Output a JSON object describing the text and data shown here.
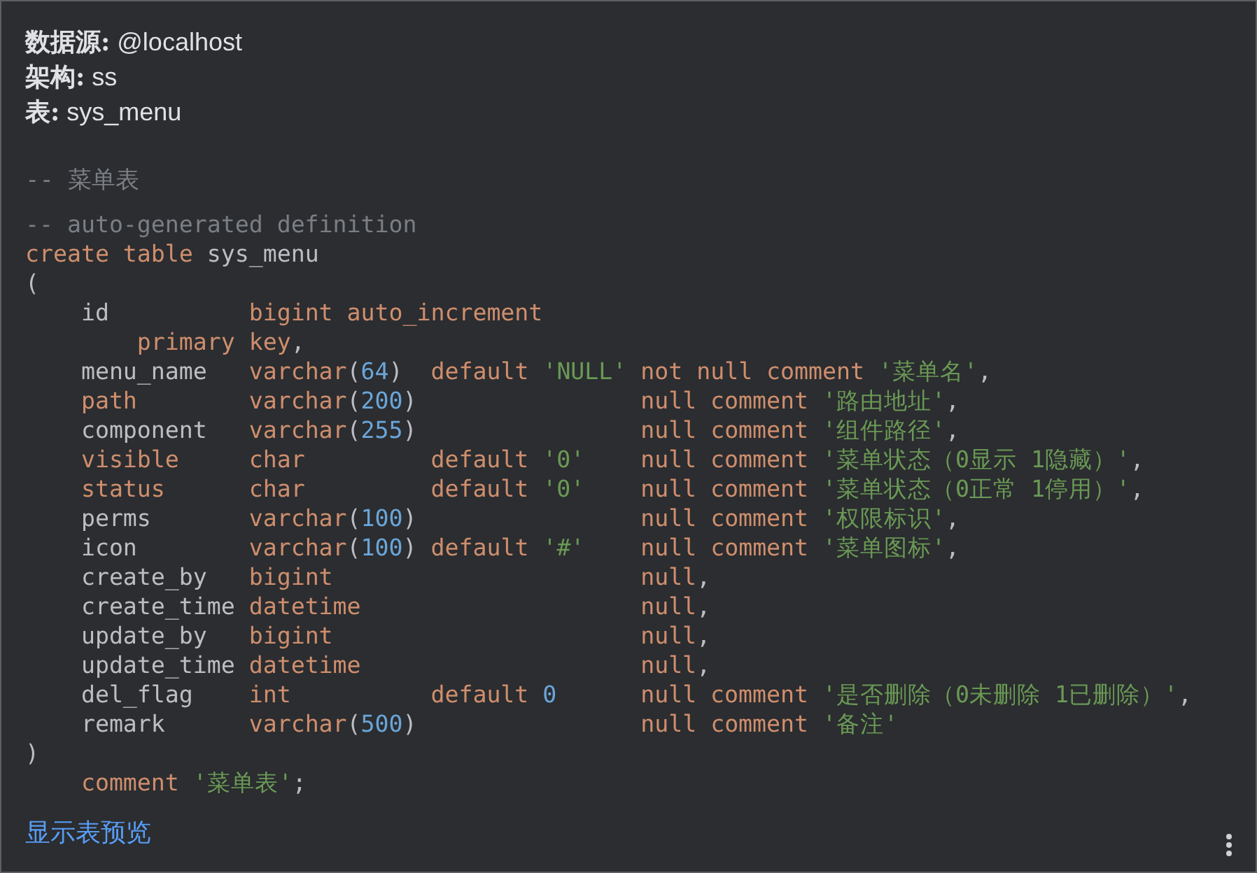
{
  "header": [
    {
      "label": "数据源:",
      "value": "@localhost"
    },
    {
      "label": "架构:",
      "value": "ss"
    },
    {
      "label": "表:",
      "value": "sys_menu"
    }
  ],
  "table_comment": "-- 菜单表",
  "code_lines": [
    [
      {
        "kind": "comment",
        "text": "-- auto-generated definition"
      }
    ],
    [
      {
        "kind": "keyword",
        "text": "create table"
      },
      {
        "kind": "identifier",
        "text": " sys_menu"
      }
    ],
    [
      {
        "kind": "punctuation",
        "text": "("
      }
    ],
    [
      {
        "kind": "identifier",
        "text": "    id          "
      },
      {
        "kind": "keyword",
        "text": "bigint auto_increment"
      }
    ],
    [
      {
        "kind": "keyword",
        "text": "        primary key"
      },
      {
        "kind": "punctuation",
        "text": ","
      }
    ],
    [
      {
        "kind": "identifier",
        "text": "    menu_name   "
      },
      {
        "kind": "keyword",
        "text": "varchar"
      },
      {
        "kind": "punctuation",
        "text": "("
      },
      {
        "kind": "number",
        "text": "64"
      },
      {
        "kind": "punctuation",
        "text": ")  "
      },
      {
        "kind": "keyword",
        "text": "default "
      },
      {
        "kind": "string",
        "text": "'NULL'"
      },
      {
        "kind": "keyword",
        "text": " not null comment "
      },
      {
        "kind": "string",
        "text": "'菜单名'"
      },
      {
        "kind": "punctuation",
        "text": ","
      }
    ],
    [
      {
        "kind": "keyword",
        "text": "    path        varchar"
      },
      {
        "kind": "punctuation",
        "text": "("
      },
      {
        "kind": "number",
        "text": "200"
      },
      {
        "kind": "punctuation",
        "text": ")                "
      },
      {
        "kind": "keyword",
        "text": "null comment "
      },
      {
        "kind": "string",
        "text": "'路由地址'"
      },
      {
        "kind": "punctuation",
        "text": ","
      }
    ],
    [
      {
        "kind": "identifier",
        "text": "    component   "
      },
      {
        "kind": "keyword",
        "text": "varchar"
      },
      {
        "kind": "punctuation",
        "text": "("
      },
      {
        "kind": "number",
        "text": "255"
      },
      {
        "kind": "punctuation",
        "text": ")                "
      },
      {
        "kind": "keyword",
        "text": "null comment "
      },
      {
        "kind": "string",
        "text": "'组件路径'"
      },
      {
        "kind": "punctuation",
        "text": ","
      }
    ],
    [
      {
        "kind": "keyword",
        "text": "    visible     char         default "
      },
      {
        "kind": "string",
        "text": "'0'"
      },
      {
        "kind": "keyword",
        "text": "    null comment "
      },
      {
        "kind": "string",
        "text": "'菜单状态（0显示 1隐藏）'"
      },
      {
        "kind": "punctuation",
        "text": ","
      }
    ],
    [
      {
        "kind": "keyword",
        "text": "    status      char         default "
      },
      {
        "kind": "string",
        "text": "'0'"
      },
      {
        "kind": "keyword",
        "text": "    null comment "
      },
      {
        "kind": "string",
        "text": "'菜单状态（0正常 1停用）'"
      },
      {
        "kind": "punctuation",
        "text": ","
      }
    ],
    [
      {
        "kind": "identifier",
        "text": "    perms       "
      },
      {
        "kind": "keyword",
        "text": "varchar"
      },
      {
        "kind": "punctuation",
        "text": "("
      },
      {
        "kind": "number",
        "text": "100"
      },
      {
        "kind": "punctuation",
        "text": ")                "
      },
      {
        "kind": "keyword",
        "text": "null comment "
      },
      {
        "kind": "string",
        "text": "'权限标识'"
      },
      {
        "kind": "punctuation",
        "text": ","
      }
    ],
    [
      {
        "kind": "identifier",
        "text": "    icon        "
      },
      {
        "kind": "keyword",
        "text": "varchar"
      },
      {
        "kind": "punctuation",
        "text": "("
      },
      {
        "kind": "number",
        "text": "100"
      },
      {
        "kind": "punctuation",
        "text": ") "
      },
      {
        "kind": "keyword",
        "text": "default "
      },
      {
        "kind": "string",
        "text": "'#'"
      },
      {
        "kind": "keyword",
        "text": "    null comment "
      },
      {
        "kind": "string",
        "text": "'菜单图标'"
      },
      {
        "kind": "punctuation",
        "text": ","
      }
    ],
    [
      {
        "kind": "identifier",
        "text": "    create_by   "
      },
      {
        "kind": "keyword",
        "text": "bigint                      null"
      },
      {
        "kind": "punctuation",
        "text": ","
      }
    ],
    [
      {
        "kind": "identifier",
        "text": "    create_time "
      },
      {
        "kind": "keyword",
        "text": "datetime                    null"
      },
      {
        "kind": "punctuation",
        "text": ","
      }
    ],
    [
      {
        "kind": "identifier",
        "text": "    update_by   "
      },
      {
        "kind": "keyword",
        "text": "bigint                      null"
      },
      {
        "kind": "punctuation",
        "text": ","
      }
    ],
    [
      {
        "kind": "identifier",
        "text": "    update_time "
      },
      {
        "kind": "keyword",
        "text": "datetime                    null"
      },
      {
        "kind": "punctuation",
        "text": ","
      }
    ],
    [
      {
        "kind": "identifier",
        "text": "    del_flag    "
      },
      {
        "kind": "keyword",
        "text": "int          default "
      },
      {
        "kind": "number",
        "text": "0"
      },
      {
        "kind": "keyword",
        "text": "      null comment "
      },
      {
        "kind": "string",
        "text": "'是否删除（0未删除 1已删除）'"
      },
      {
        "kind": "punctuation",
        "text": ","
      }
    ],
    [
      {
        "kind": "identifier",
        "text": "    remark      "
      },
      {
        "kind": "keyword",
        "text": "varchar"
      },
      {
        "kind": "punctuation",
        "text": "("
      },
      {
        "kind": "number",
        "text": "500"
      },
      {
        "kind": "punctuation",
        "text": ")                "
      },
      {
        "kind": "keyword",
        "text": "null comment "
      },
      {
        "kind": "string",
        "text": "'备注'"
      }
    ],
    [
      {
        "kind": "punctuation",
        "text": ")"
      }
    ],
    [
      {
        "kind": "keyword",
        "text": "    comment "
      },
      {
        "kind": "string",
        "text": "'菜单表'"
      },
      {
        "kind": "punctuation",
        "text": ";"
      }
    ]
  ],
  "preview_link": "显示表预览"
}
